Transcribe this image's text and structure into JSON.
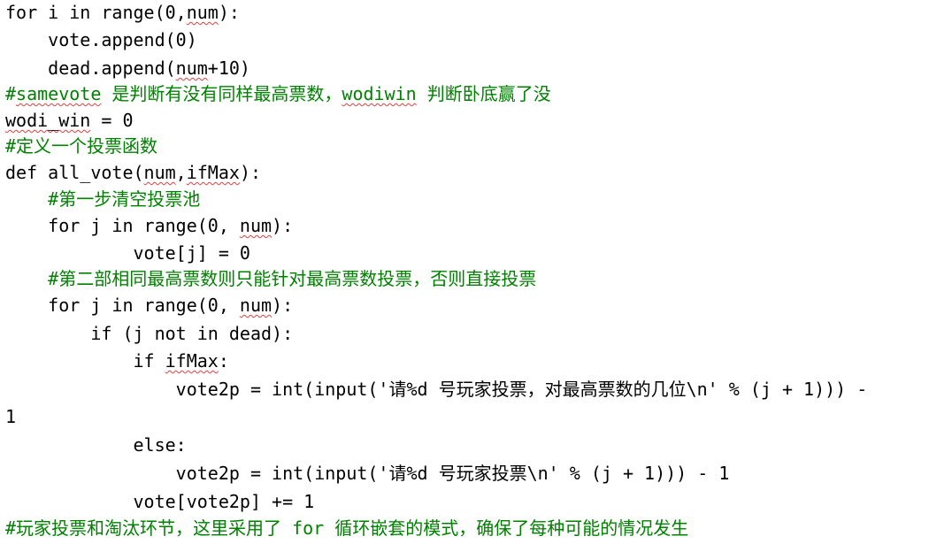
{
  "colors": {
    "code_text": "#000000",
    "comment_text": "#008000",
    "spell_check_underline": "#e04040",
    "background": "#ffffff"
  },
  "lines": [
    {
      "text": "for i in range(0,num):",
      "kind": "code"
    },
    {
      "text": "    vote.append(0)",
      "kind": "code"
    },
    {
      "text": "    dead.append(num+10)",
      "kind": "code"
    },
    {
      "text": "#samevote 是判断有没有同样最高票数，wodiwin 判断卧底赢了没",
      "kind": "comment"
    },
    {
      "text": "wodi_win = 0",
      "kind": "code"
    },
    {
      "text": "#定义一个投票函数",
      "kind": "comment"
    },
    {
      "text": "def all_vote(num,ifMax):",
      "kind": "code"
    },
    {
      "text": "    #第一步清空投票池",
      "kind": "comment"
    },
    {
      "text": "    for j in range(0, num):",
      "kind": "code"
    },
    {
      "text": "            vote[j] = 0",
      "kind": "code"
    },
    {
      "text": "    #第二部相同最高票数则只能针对最高票数投票，否则直接投票",
      "kind": "comment"
    },
    {
      "text": "    for j in range(0, num):",
      "kind": "code"
    },
    {
      "text": "        if (j not in dead):",
      "kind": "code"
    },
    {
      "text": "            if ifMax:",
      "kind": "code"
    },
    {
      "text": "                vote2p = int(input('请%d 号玩家投票，对最高票数的几位\\n' % (j + 1))) -",
      "kind": "code"
    },
    {
      "text": "1",
      "kind": "code"
    },
    {
      "text": "            else:",
      "kind": "code"
    },
    {
      "text": "                vote2p = int(input('请%d 号玩家投票\\n' % (j + 1))) - 1",
      "kind": "code"
    },
    {
      "text": "            vote[vote2p] += 1",
      "kind": "code"
    },
    {
      "text": "#玩家投票和淘汰环节，这里采用了 for 循环嵌套的模式，确保了每种可能的情况发生",
      "kind": "comment"
    }
  ]
}
